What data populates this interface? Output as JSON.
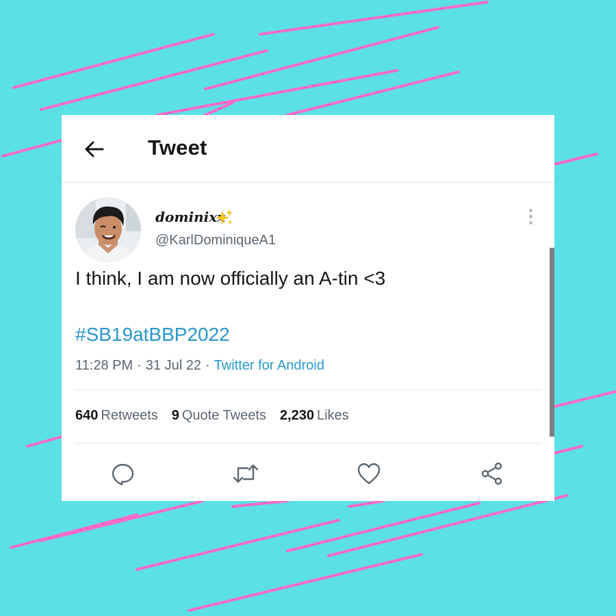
{
  "header": {
    "title": "Tweet",
    "back_icon": "arrow-left-icon"
  },
  "tweet": {
    "display_name": "dominixx",
    "name_emoji": "sparkles-icon",
    "handle": "@KarlDominiqueA1",
    "text": "I think, I am now officially an A-tin <3",
    "hashtag": "#SB19atBBP2022",
    "time": "11:28 PM",
    "date": "31 Jul 22",
    "separator": "·",
    "source": "Twitter for Android",
    "more_icon": "more-vertical-icon"
  },
  "stats": {
    "retweets": {
      "count": "640",
      "label": "Retweets"
    },
    "quote_tweets": {
      "count": "9",
      "label": "Quote Tweets"
    },
    "likes": {
      "count": "2,230",
      "label": "Likes"
    }
  },
  "actions": [
    {
      "icon": "reply-icon"
    },
    {
      "icon": "retweet-icon"
    },
    {
      "icon": "like-icon"
    },
    {
      "icon": "share-icon"
    }
  ],
  "colors": {
    "background": "#5ae0e6",
    "accent_lines": "#ff6ac8",
    "link": "#2a97cc",
    "text": "#14171a",
    "secondary_text": "#5b6670"
  }
}
